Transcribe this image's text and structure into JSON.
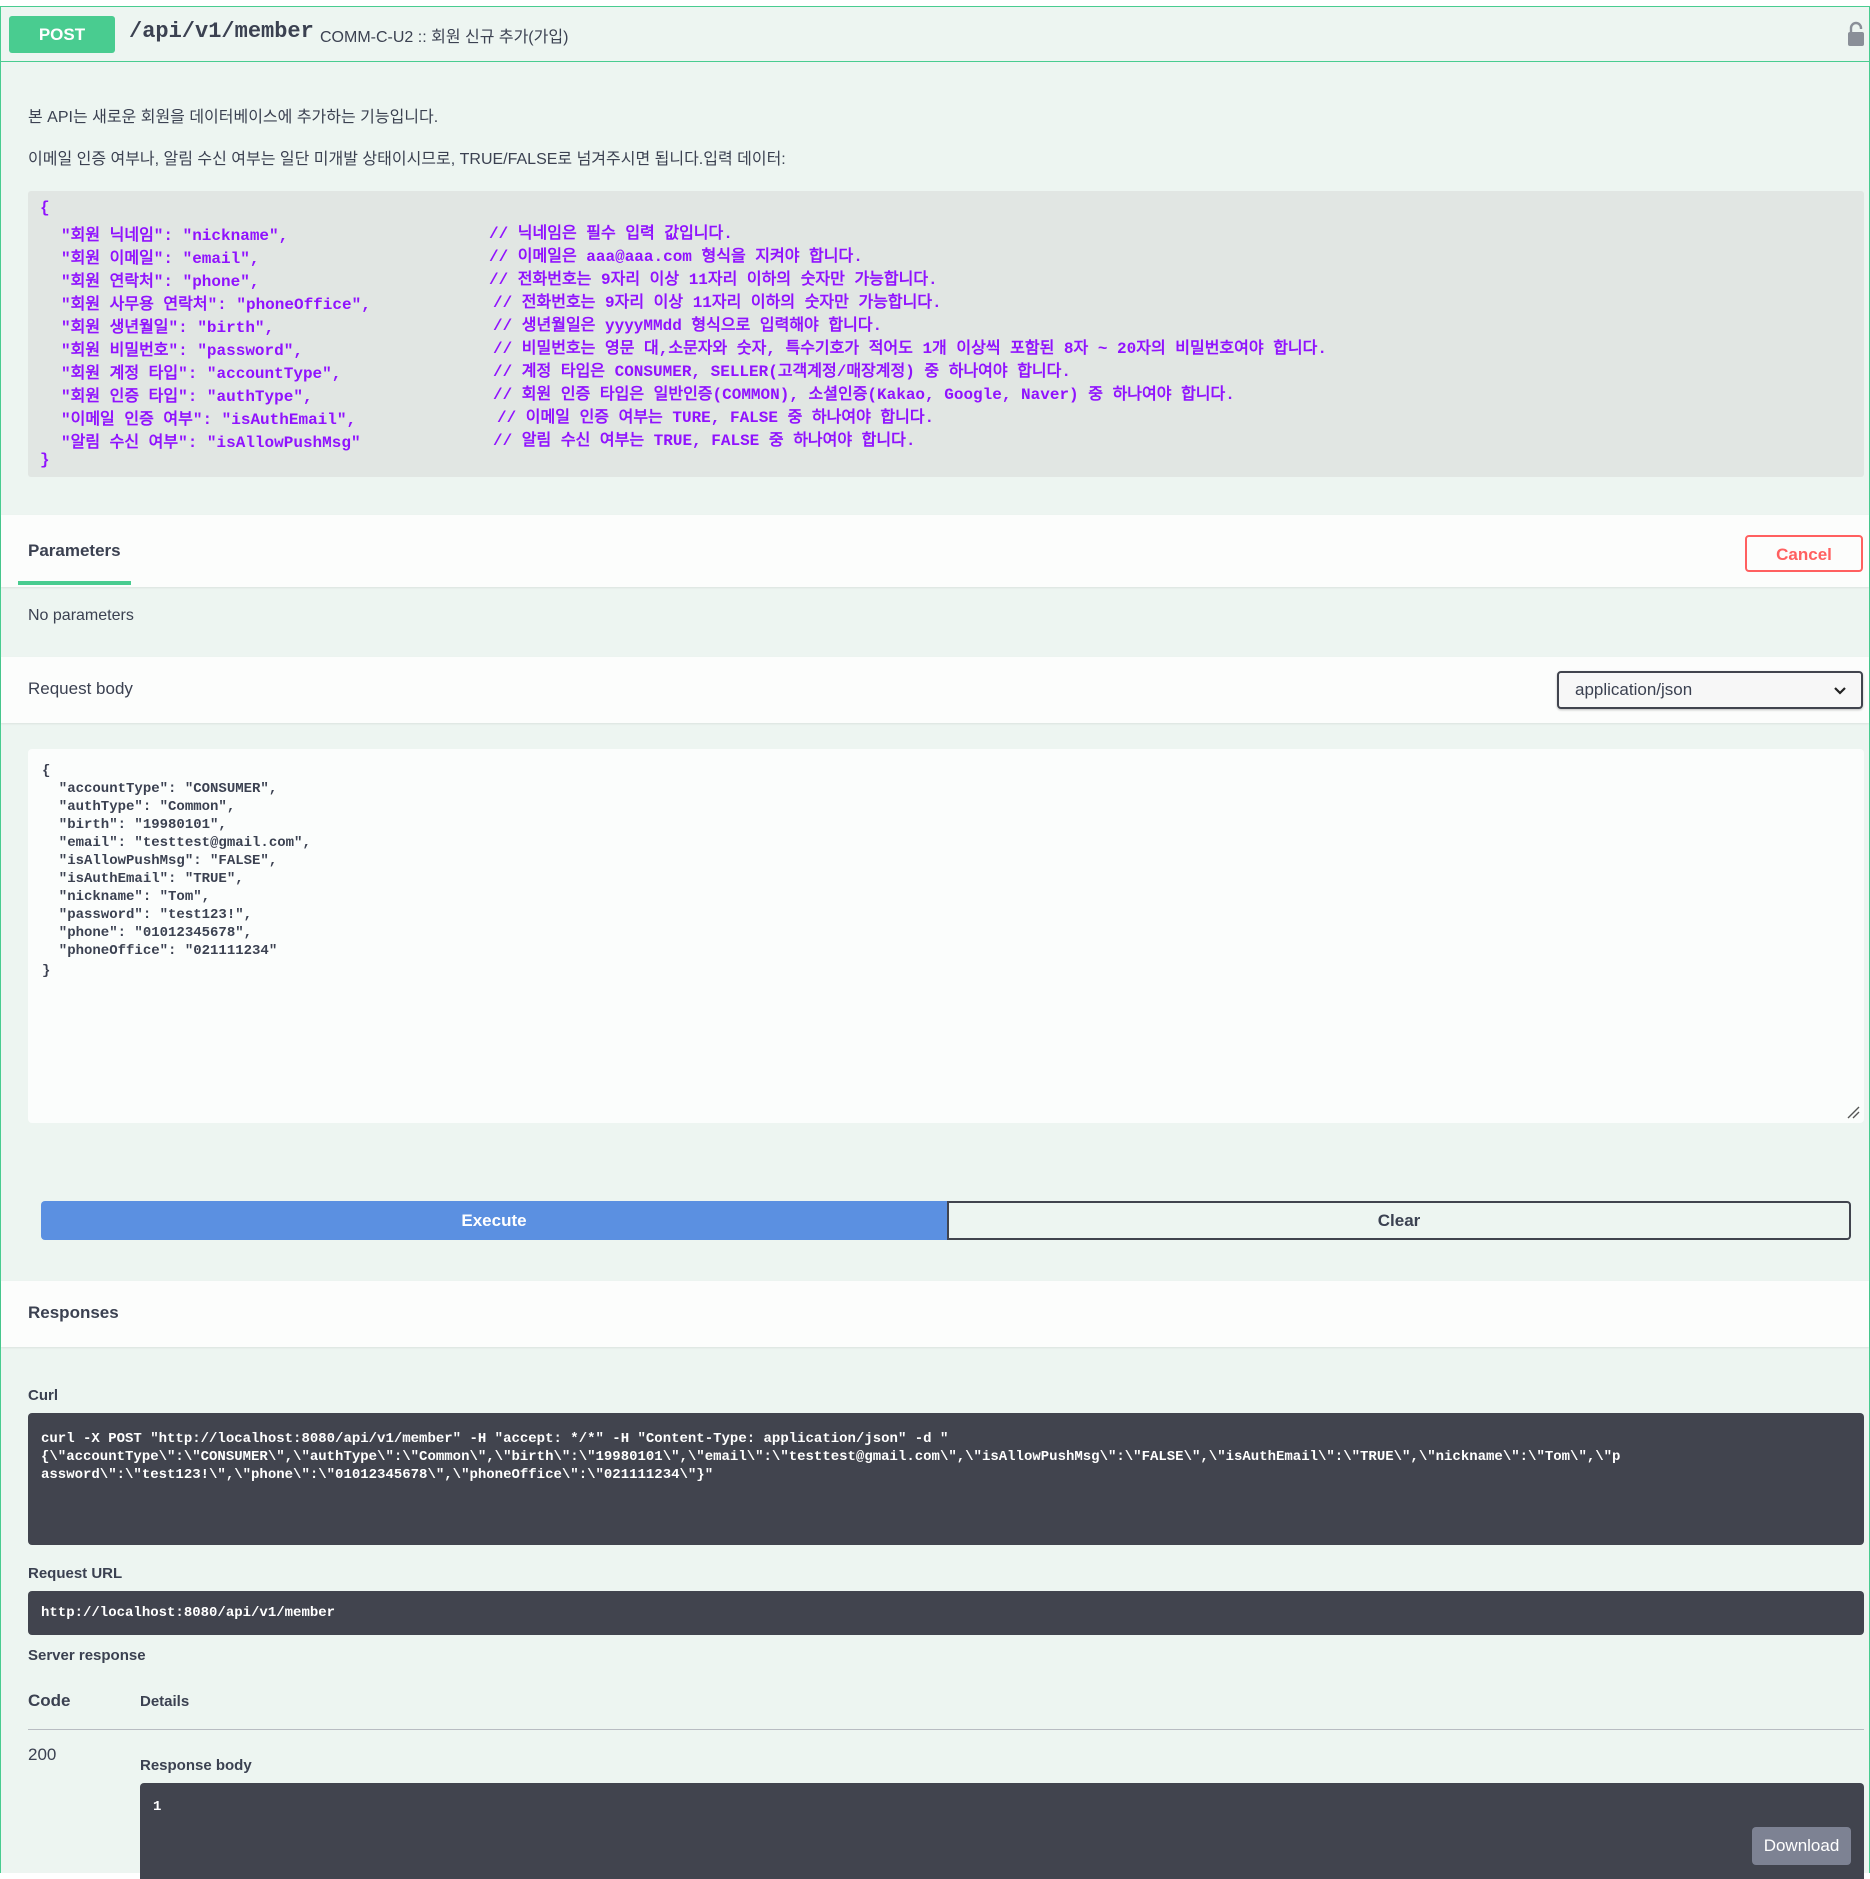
{
  "summary": {
    "method": "POST",
    "path": "/api/v1/member",
    "description": "COMM-C-U2 :: 회원 신규 추가(가입)",
    "lock_icon": "unlocked-padlock-icon"
  },
  "description": {
    "p1": "본 API는 새로운 회원을 데이터베이스에 추가하는 기능입니다.",
    "p2": "이메일 인증 여부나, 알림 수신 여부는 일단 미개발 상태이시므로, TRUE/FALSE로 넘겨주시면 됩니다.입력 데이터:",
    "spec_open": "{",
    "spec_close": "}",
    "spec_lines": [
      {
        "key": "\"회원 닉네임\": \"nickname\",",
        "comment": "// 닉네임은 필수 입력 값입니다."
      },
      {
        "key": "\"회원 이메일\": \"email\",",
        "comment": "// 이메일은 aaa@aaa.com 형식을 지켜야 합니다."
      },
      {
        "key": "\"회원 연락처\": \"phone\",",
        "comment": "// 전화번호는 9자리 이상 11자리 이하의 숫자만 가능합니다."
      },
      {
        "key": "\"회원 사무용 연락처\": \"phoneOffice\",",
        "comment": "// 전화번호는 9자리 이상 11자리 이하의 숫자만 가능합니다."
      },
      {
        "key": "\"회원 생년월일\": \"birth\",",
        "comment": "// 생년월일은 yyyyMMdd 형식으로 입력해야 합니다."
      },
      {
        "key": "\"회원 비밀번호\": \"password\",",
        "comment": "// 비밀번호는 영문 대,소문자와 숫자, 특수기호가 적어도 1개 이상씩 포함된 8자 ~ 20자의 비밀번호여야 합니다."
      },
      {
        "key": "\"회원 계정 타입\": \"accountType\",",
        "comment": "// 계정 타입은 CONSUMER, SELLER(고객계정/매장계정) 중 하나여야 합니다."
      },
      {
        "key": "\"회원 인증 타입\": \"authType\",",
        "comment": "// 회원 인증 타입은 일반인증(COMMON), 소셜인증(Kakao, Google, Naver) 중 하나여야 합니다."
      },
      {
        "key": "\"이메일 인증 여부\": \"isAuthEmail\",",
        "comment": "// 이메일 인증 여부는 TURE, FALSE 중 하나여야 합니다."
      },
      {
        "key": "\"알림 수신 여부\": \"isAllowPushMsg\"",
        "comment": "// 알림 수신 여부는 TRUE, FALSE 중 하나여야 합니다."
      }
    ]
  },
  "parameters": {
    "title": "Parameters",
    "cancel_label": "Cancel",
    "empty_text": "No parameters"
  },
  "request_body": {
    "title": "Request body",
    "content_type": "application/json",
    "chevron_icon": "chevron-down-icon",
    "editor_lines": [
      "{",
      "  \"accountType\": \"CONSUMER\",",
      "  \"authType\": \"Common\",",
      "  \"birth\": \"19980101\",",
      "  \"email\": \"testtest@gmail.com\",",
      "  \"isAllowPushMsg\": \"FALSE\",",
      "  \"isAuthEmail\": \"TRUE\",",
      "  \"nickname\": \"Tom\",",
      "  \"password\": \"test123!\",",
      "  \"phone\": \"01012345678\",",
      "  \"phoneOffice\": \"021111234\"",
      "}"
    ]
  },
  "actions": {
    "execute_label": "Execute",
    "clear_label": "Clear"
  },
  "responses": {
    "title": "Responses",
    "curl_label": "Curl",
    "curl_lines": [
      "curl -X POST \"http://localhost:8080/api/v1/member\" -H \"accept: */*\" -H \"Content-Type: application/json\" -d \"",
      "{\\\"accountType\\\":\\\"CONSUMER\\\",\\\"authType\\\":\\\"Common\\\",\\\"birth\\\":\\\"19980101\\\",\\\"email\\\":\\\"testtest@gmail.com\\\",\\\"isAllowPushMsg\\\":\\\"FALSE\\\",\\\"isAuthEmail\\\":\\\"TRUE\\\",\\\"nickname\\\":\\\"Tom\\\",\\\"p",
      "assword\\\":\\\"test123!\\\",\\\"phone\\\":\\\"01012345678\\\",\\\"phoneOffice\\\":\\\"021111234\\\"}\""
    ],
    "request_url_label": "Request URL",
    "request_url": "http://localhost:8080/api/v1/member",
    "server_response_label": "Server response",
    "code_header": "Code",
    "details_header": "Details",
    "code": "200",
    "response_body_label": "Response body",
    "response_body": "1",
    "download_label": "Download"
  },
  "colors": {
    "post_accent": "#49cc90",
    "block_bg": "#edf5f1",
    "spec_text": "#9012fe",
    "execute_bg": "#5b90e1",
    "cancel": "#ff6060",
    "dark_block": "#41444e"
  }
}
